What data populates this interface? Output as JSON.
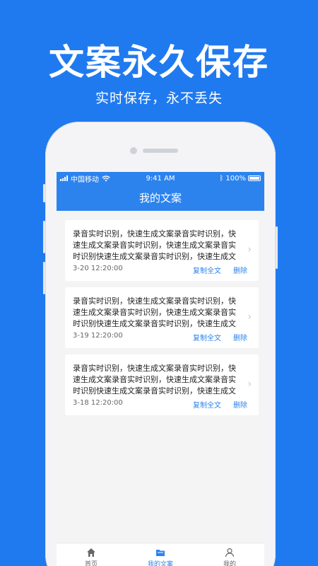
{
  "promo": {
    "headline": "文案永久保存",
    "subline": "实时保存，永不丢失"
  },
  "status_bar": {
    "carrier": "中国移动",
    "time": "9:41 AM",
    "battery": "100%"
  },
  "nav": {
    "title": "我的文案"
  },
  "cards": [
    {
      "text": "录音实时识别，快速生成文案录音实时识别，快速生成文案录音实时识别，快速生成文案录音实时识别快速生成文案录音实时识别，快速生成文案成",
      "date": "3-20 12:20:00",
      "copy_label": "复制全文",
      "delete_label": "删除"
    },
    {
      "text": "录音实时识别，快速生成文案录音实时识别，快速生成文案录音实时识别，快速生成文案录音实时识别快速生成文案录音实时识别，快速生成文案成",
      "date": "3-19 12:20:00",
      "copy_label": "复制全文",
      "delete_label": "删除"
    },
    {
      "text": "录音实时识别，快速生成文案录音实时识别，快速生成文案录音实时识别，快速生成文案录音实时识别快速生成文案录音实时识别，快速生成文案成",
      "date": "3-18 12:20:00",
      "copy_label": "复制全文",
      "delete_label": "删除"
    }
  ],
  "tabbar": [
    {
      "label": "首页",
      "icon": "home-icon",
      "active": false
    },
    {
      "label": "我的文案",
      "icon": "folder-icon",
      "active": true
    },
    {
      "label": "我的",
      "icon": "user-icon",
      "active": false
    }
  ],
  "colors": {
    "brand": "#1f7af0",
    "accent": "#2c83ee"
  }
}
